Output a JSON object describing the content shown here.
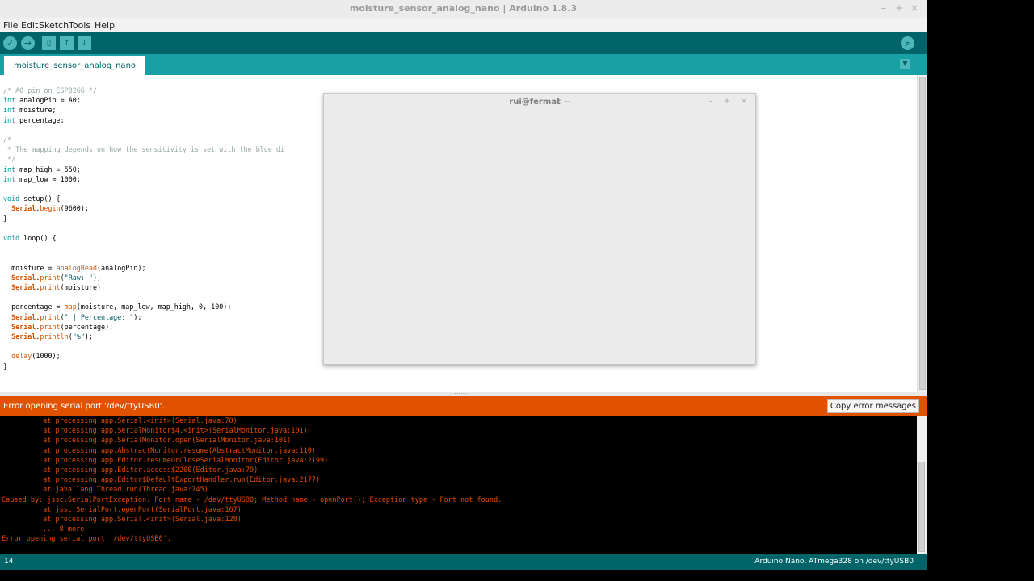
{
  "window": {
    "title": "moisture_sensor_analog_nano | Arduino 1.8.3",
    "controls": [
      "–",
      "+",
      "×"
    ]
  },
  "menu": [
    "File",
    "Edit",
    "Sketch",
    "Tools",
    "Help"
  ],
  "toolbar": {
    "buttons": [
      "verify-icon",
      "upload-icon",
      "new-icon",
      "open-icon",
      "save-icon"
    ],
    "serial_monitor": "serial-monitor-icon"
  },
  "tabs": [
    {
      "label": "moisture_sensor_analog_nano"
    }
  ],
  "editor": {
    "lines": [
      "/* A0 pin on ESP8266 */",
      "int analogPin = A0;",
      "int moisture;",
      "int percentage;",
      "",
      "/*",
      " * The mapping depends on how the sensitivity is set with the blue di",
      " */",
      "int map_high = 550;",
      "int map_low = 1000;",
      "",
      "void setup() {",
      "  Serial.begin(9600);",
      "}",
      "",
      "void loop() {",
      "",
      "",
      "  moisture = analogRead(analogPin);",
      "  Serial.print(\"Raw: \");",
      "  Serial.print(moisture);",
      "",
      "  percentage = map(moisture, map_low, map_high, 0, 100);",
      "  Serial.print(\" | Percentage: \");",
      "  Serial.print(percentage);",
      "  Serial.println(\"%\");",
      "",
      "  delay(1000);",
      "}"
    ]
  },
  "status": {
    "message": "Error opening serial port '/dev/ttyUSB0'.",
    "copy_button": "Copy error messages"
  },
  "console": {
    "lines": [
      "\tat processing.app.Serial.<init>(Serial.java:78)",
      "\tat processing.app.SerialMonitor$4.<init>(SerialMonitor.java:101)",
      "\tat processing.app.SerialMonitor.open(SerialMonitor.java:101)",
      "\tat processing.app.AbstractMonitor.resume(AbstractMonitor.java:110)",
      "\tat processing.app.Editor.resumeOrCloseSerialMonitor(Editor.java:2199)",
      "\tat processing.app.Editor.access$2200(Editor.java:79)",
      "\tat processing.app.Editor$DefaultExportHandler.run(Editor.java:2177)",
      "\tat java.lang.Thread.run(Thread.java:745)",
      "Caused by: jssc.SerialPortException: Port name - /dev/ttyUSB0; Method name - openPort(); Exception type - Port not found.",
      "\tat jssc.SerialPort.openPort(SerialPort.java:167)",
      "\tat processing.app.Serial.<init>(Serial.java:128)",
      "\t... 8 more",
      "Error opening serial port '/dev/ttyUSB0'."
    ]
  },
  "footer": {
    "line_number": "14",
    "board": "Arduino Nano, ATmega328 on /dev/ttyUSB0"
  },
  "terminal": {
    "title": "rui@fermat ~",
    "controls": [
      "–",
      "+",
      "×"
    ]
  },
  "colors": {
    "toolbar": "#006468",
    "tabbar": "#17a1a5",
    "error_bar": "#e05200",
    "console_text": "#e34c00"
  }
}
